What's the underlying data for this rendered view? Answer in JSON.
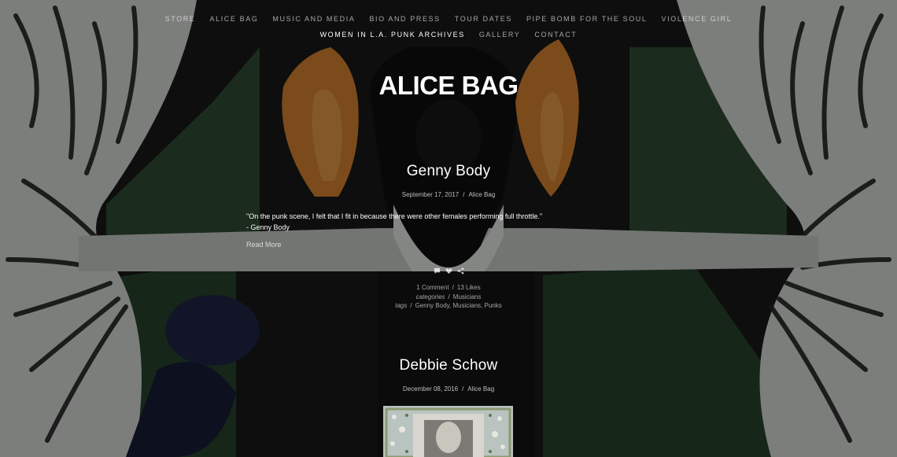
{
  "nav": {
    "row1": [
      "STORE",
      "ALICE BAG",
      "MUSIC AND MEDIA",
      "BIO AND PRESS",
      "TOUR DATES",
      "PIPE BOMB FOR THE SOUL",
      "VIOLENCE GIRL"
    ],
    "row2": [
      "WOMEN IN L.A. PUNK ARCHIVES",
      "GALLERY",
      "CONTACT"
    ],
    "active": "WOMEN IN L.A. PUNK ARCHIVES"
  },
  "site_title": "ALICE BAG",
  "posts": [
    {
      "title": "Genny Body",
      "date": "September 17, 2017",
      "author": "Alice Bag",
      "excerpt_line1": "\"On the punk scene, I felt that I fit in because there were other females performing full throttle.\"",
      "excerpt_line2": "- Genny Body",
      "read_more": "Read More",
      "comments": "1 Comment",
      "likes": "13 Likes",
      "categories_label": "categories",
      "categories": "Musicians",
      "tags_label": "tags",
      "tags": "Genny Body, Musicians, Punks",
      "icons": [
        "comment-icon",
        "heart-icon",
        "share-icon"
      ]
    },
    {
      "title": "Debbie Schow",
      "date": "December 08, 2016",
      "author": "Alice Bag"
    }
  ],
  "separators": {
    "slash": "/"
  },
  "colors": {
    "background": "#1b1d1b",
    "curtain_green": "#2f4a33",
    "flame_orange": "#c9792c",
    "text": "#ffffff"
  }
}
